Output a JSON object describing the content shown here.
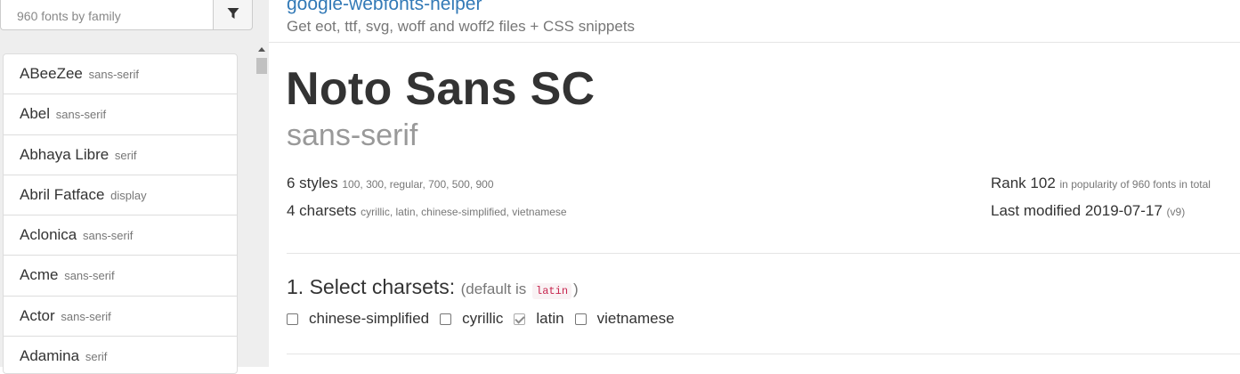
{
  "search": {
    "placeholder": "960 fonts by family",
    "value": "",
    "filter_icon": "filter-icon"
  },
  "fonts": [
    {
      "family": "ABeeZee",
      "category": "sans-serif"
    },
    {
      "family": "Abel",
      "category": "sans-serif"
    },
    {
      "family": "Abhaya Libre",
      "category": "serif"
    },
    {
      "family": "Abril Fatface",
      "category": "display"
    },
    {
      "family": "Aclonica",
      "category": "sans-serif"
    },
    {
      "family": "Acme",
      "category": "sans-serif"
    },
    {
      "family": "Actor",
      "category": "sans-serif"
    },
    {
      "family": "Adamina",
      "category": "serif"
    }
  ],
  "header": {
    "title": "google-webfonts-helper",
    "subtitle": "Get eot, ttf, svg, woff and woff2 files + CSS snippets"
  },
  "font": {
    "name": "Noto Sans SC",
    "category": "sans-serif",
    "styles_count": "6 styles",
    "styles_list": "100, 300, regular, 700, 500, 900",
    "charsets_count": "4 charsets",
    "charsets_list": "cyrillic, latin, chinese-simplified, vietnamese",
    "rank_label": "Rank 102",
    "rank_note": "in popularity of 960 fonts in total",
    "modified_label": "Last modified 2019-07-17",
    "version": "(v9)"
  },
  "select_charsets": {
    "heading": "1. Select charsets:",
    "hint_prefix": "(default is",
    "default_code": "latin",
    "hint_suffix": ")",
    "options": [
      {
        "label": "chinese-simplified",
        "checked": false
      },
      {
        "label": "cyrillic",
        "checked": false
      },
      {
        "label": "latin",
        "checked": true
      },
      {
        "label": "vietnamese",
        "checked": false
      }
    ]
  },
  "colors": {
    "link": "#337ab7",
    "muted": "#777777",
    "code": "#c7254e",
    "sidebar_bg": "#eeeeee"
  }
}
